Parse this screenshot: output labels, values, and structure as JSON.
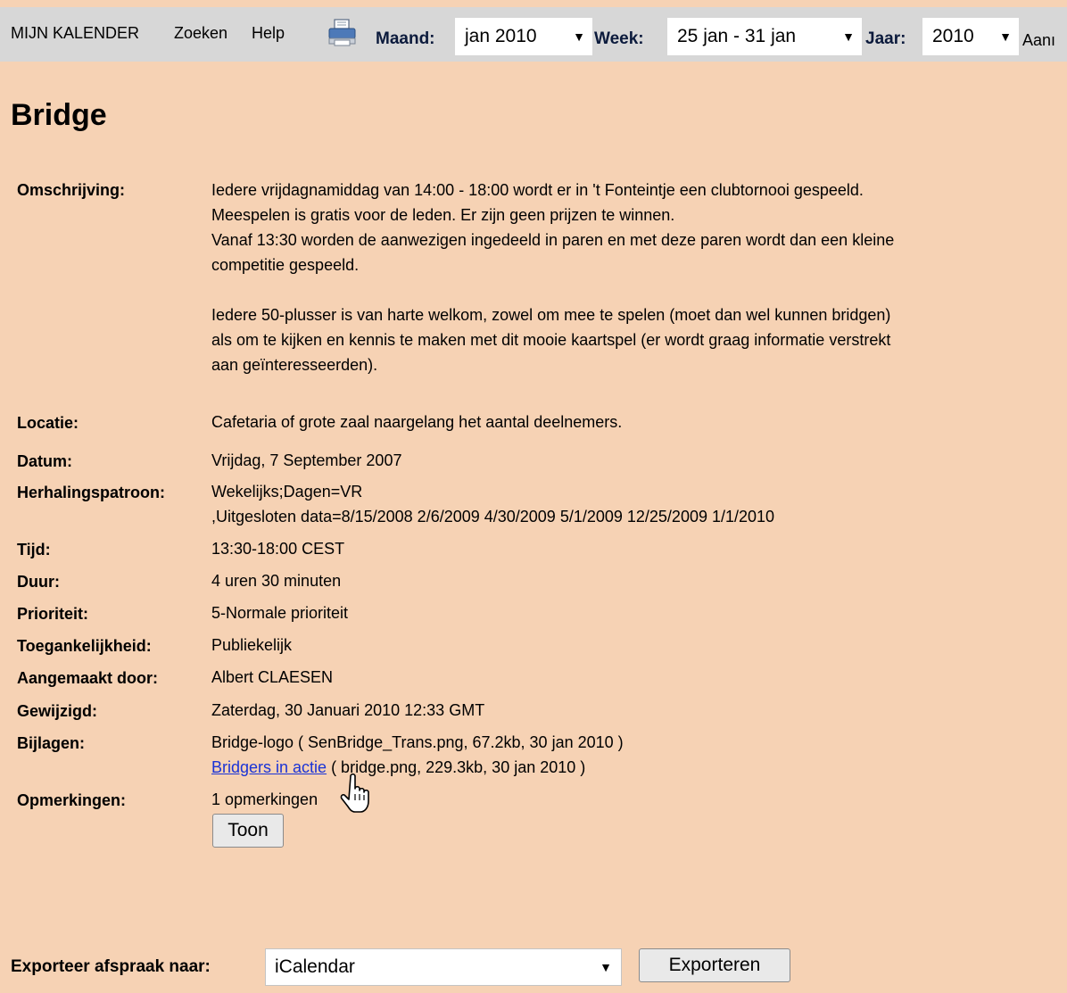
{
  "nav": {
    "my_calendar": "MIJN KALENDER",
    "search": "Zoeken",
    "help": "Help",
    "print_icon": "printer-icon"
  },
  "selectors": {
    "month_label": "Maand:",
    "month_value": "jan 2010",
    "week_label": "Week:",
    "week_value": "25 jan - 31 jan",
    "year_label": "Jaar:",
    "year_value": "2010",
    "cut_text": "Aanı"
  },
  "event": {
    "title": "Bridge",
    "description_label": "Omschrijving:",
    "description_lines": [
      "Iedere vrijdagnamiddag van 14:00 - 18:00 wordt er in 't Fonteintje een clubtornooi gespeeld.",
      "Meespelen is gratis voor de leden. Er zijn geen prijzen te winnen.",
      "Vanaf 13:30 worden de aanwezigen ingedeeld in paren en met deze paren wordt dan een kleine",
      "competitie gespeeld.",
      "Iedere 50-plusser is van harte welkom, zowel om mee te spelen (moet dan wel kunnen bridgen)",
      "als om te kijken en kennis te maken met dit mooie kaartspel (er wordt graag informatie verstrekt",
      "aan geïnteresseerden)."
    ],
    "location_label": "Locatie:",
    "location": "Cafetaria of grote zaal naargelang het aantal deelnemers.",
    "date_label": "Datum:",
    "date": "Vrijdag, 7 September 2007",
    "repeat_label": "Herhalingspatroon:",
    "repeat_line1": "Wekelijks;Dagen=VR",
    "repeat_line2": ",Uitgesloten data=8/15/2008 2/6/2009 4/30/2009 5/1/2009 12/25/2009 1/1/2010",
    "time_label": "Tijd:",
    "time": "13:30-18:00 CEST",
    "duration_label": "Duur:",
    "duration": "4 uren 30 minuten",
    "priority_label": "Prioriteit:",
    "priority": "5-Normale prioriteit",
    "access_label": "Toegankelijkheid:",
    "access": "Publiekelijk",
    "created_label": "Aangemaakt door:",
    "created_by": "Albert CLAESEN",
    "modified_label": "Gewijzigd:",
    "modified": "Zaterdag, 30 Januari 2010 12:33 GMT",
    "attachments_label": "Bijlagen:",
    "attachment1": "Bridge-logo ( SenBridge_Trans.png, 67.2kb, 30 jan 2010 )",
    "attachment2_link": "Bridgers in actie",
    "attachment2_info": " ( bridge.png, 229.3kb, 30 jan 2010 )",
    "comments_label": "Opmerkingen:",
    "comments": "1 opmerkingen",
    "show_button": "Toon"
  },
  "export": {
    "label": "Exporteer afspraak naar:",
    "format": "iCalendar",
    "button": "Exporteren"
  },
  "colors": {
    "page_bg": "#f6d2b4",
    "topbar_bg": "#d7d7d7",
    "link": "#1a33d6"
  }
}
